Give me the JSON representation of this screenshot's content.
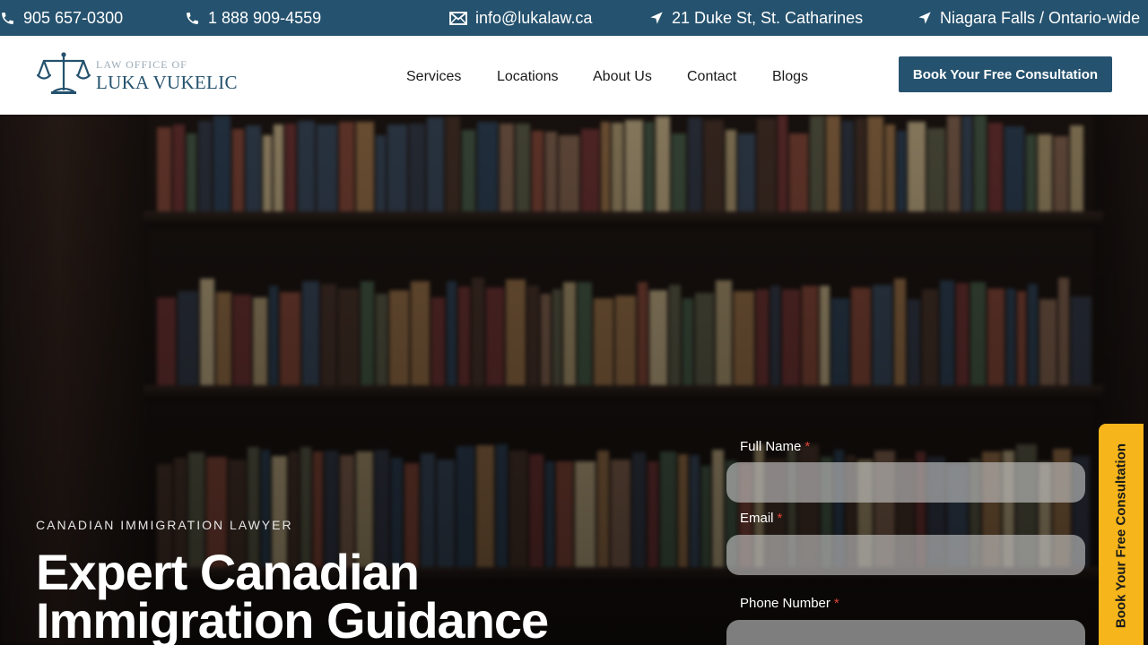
{
  "topbar": {
    "phone1": "905 657-0300",
    "phone2": "1 888 909-4559",
    "email": "info@lukalaw.ca",
    "address": "21 Duke St, St. Catharines",
    "region": "Niagara Falls / Ontario-wide",
    "icons": [
      "phone-icon",
      "phone-icon",
      "mail-icon",
      "location-arrow-icon",
      "location-arrow-icon"
    ]
  },
  "header": {
    "logo_small": "LAW OFFICE OF",
    "logo_big": "LUKA VUKELIC",
    "nav": [
      "Services",
      "Locations",
      "About Us",
      "Contact",
      "Blogs"
    ],
    "cta": "Book Your Free Consultation"
  },
  "hero": {
    "eyebrow": "CANADIAN IMMIGRATION LAWYER",
    "title": "Expert Canadian Immigration Guidance"
  },
  "form": {
    "full_name_label": "Full Name",
    "email_label": "Email",
    "phone_label": "Phone Number",
    "required_mark": "*"
  },
  "side_tab": {
    "label": "Book Your Free Consultation"
  },
  "colors": {
    "brand": "#25526e",
    "accent": "#f5b51b",
    "required": "#e0443a"
  }
}
